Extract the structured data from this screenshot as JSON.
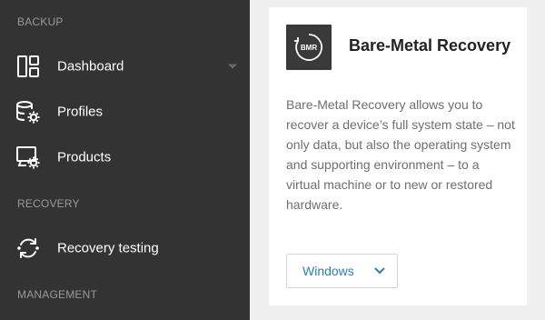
{
  "sidebar": {
    "sections": [
      {
        "title": "BACKUP"
      },
      {
        "title": "RECOVERY"
      },
      {
        "title": "MANAGEMENT"
      }
    ],
    "items": [
      {
        "label": "Dashboard",
        "icon": "dashboard-icon"
      },
      {
        "label": "Profiles",
        "icon": "profiles-gear-icon"
      },
      {
        "label": "Products",
        "icon": "products-gear-icon"
      },
      {
        "label": "Recovery testing",
        "icon": "recovery-cycle-icon"
      }
    ]
  },
  "card": {
    "logo_text": "BMR",
    "title": "Bare-Metal Recovery",
    "description": "Bare-Metal Recovery allows you to recover a device’s full system state – not only data, but also the operating system and supporting environment – to a virtual machine or to new or restored hardware.",
    "os_select": {
      "value": "Windows"
    }
  },
  "colors": {
    "sidebar_bg": "#333333",
    "section_title": "#9a9a9a",
    "main_bg": "#f0f0f0",
    "card_bg": "#ffffff",
    "link": "#2a7fb8",
    "logo_bg": "#3a3a3a"
  }
}
